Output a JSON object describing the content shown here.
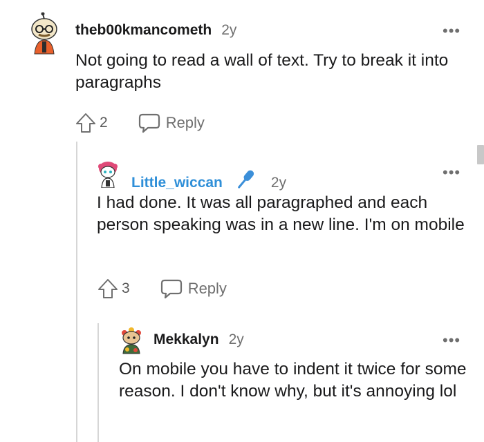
{
  "comments": [
    {
      "username": "theb00kmancometh",
      "time": "2y",
      "body": "Not going to read a wall of text. Try to break it into paragraphs",
      "votes": "2",
      "reply_label": "Reply",
      "menu_label": "•••",
      "avatar_icon": "reddit-avatar-glasses-orange",
      "badge_icon": null
    },
    {
      "username": "Little_wiccan",
      "time": "2y",
      "body": "I had done. It was all paragraphed and each person speaking was in a new line. I'm on mobile",
      "votes": "3",
      "reply_label": "Reply",
      "menu_label": "•••",
      "avatar_icon": "reddit-avatar-pink-hair",
      "badge_icon": "microphone-icon",
      "username_color": "#2f8fd8"
    },
    {
      "username": "Mekkalyn",
      "time": "2y",
      "body": "On mobile you have to indent it twice for some reason. I don't know why, but it's annoying lol",
      "menu_label": "•••",
      "avatar_icon": "reddit-avatar-animal-flowers",
      "badge_icon": null
    }
  ],
  "colors": {
    "text": "#1a1a1b",
    "meta": "#6f6f6f",
    "mod_user": "#2f8fd8",
    "thread_line": "#d6d6d6"
  }
}
